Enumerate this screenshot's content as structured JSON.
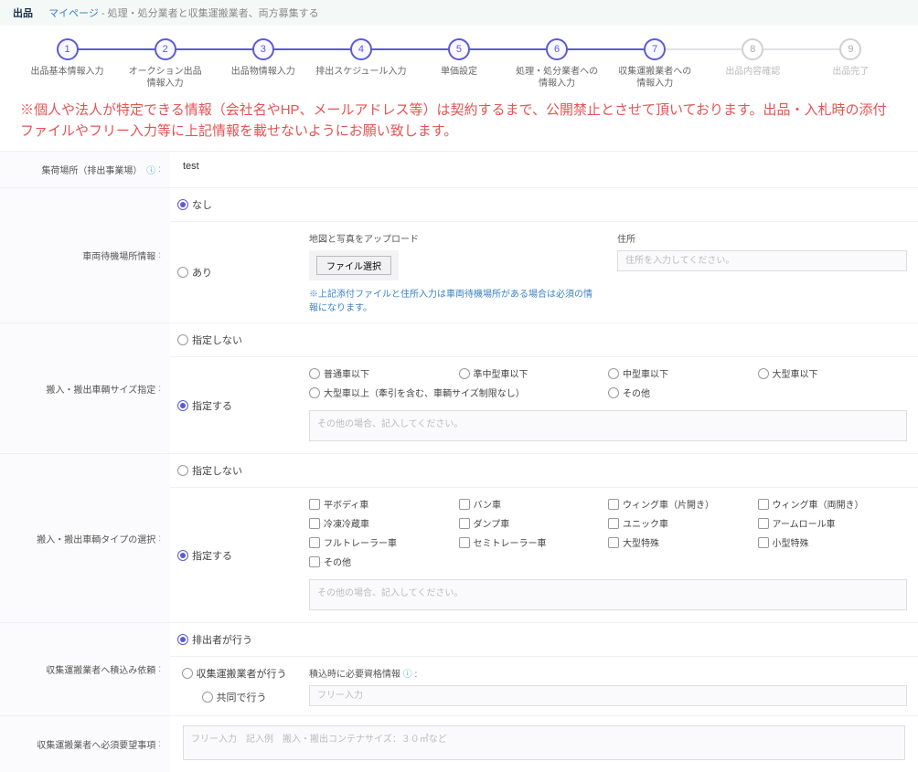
{
  "crumb": {
    "brand": "出品",
    "mypage": "マイページ",
    "text": "- 処理・処分業者と収集運搬業者、両方募集する"
  },
  "steps": [
    {
      "n": "1",
      "l": "出品基本情報入力",
      "state": "done"
    },
    {
      "n": "2",
      "l": "オークション出品\n情報入力",
      "state": "done"
    },
    {
      "n": "3",
      "l": "出品物情報入力",
      "state": "done"
    },
    {
      "n": "4",
      "l": "排出スケジュール入力",
      "state": "done"
    },
    {
      "n": "5",
      "l": "単価設定",
      "state": "done"
    },
    {
      "n": "6",
      "l": "処理・処分業者への\n情報入力",
      "state": "done"
    },
    {
      "n": "7",
      "l": "収集運搬業者への\n情報入力",
      "state": "done prefuture"
    },
    {
      "n": "8",
      "l": "出品内容確認",
      "state": "future"
    },
    {
      "n": "9",
      "l": "出品完了",
      "state": "future"
    }
  ],
  "warn": "※個人や法人が特定できる情報（会社名やHP、メールアドレス等）は契約するまで、公開禁止とさせて頂いております。出品・入札時の添付ファイルやフリー入力等に上記情報を載せないようにお願い致します。",
  "labels": {
    "pickup": "集荷場所（排出事業場）",
    "parking": "車両待機場所情報",
    "size": "搬入・搬出車輌サイズ指定",
    "type": "搬入・搬出車輌タイプの選択",
    "loadreq": "収集運搬業者へ積込み依頼",
    "must": "収集運搬業者へ必須要望事項"
  },
  "pickup_value": "test",
  "radio": {
    "none": "なし",
    "yes": "あり",
    "nospec": "指定しない",
    "spec": "指定する",
    "emitter": "排出者が行う",
    "collector": "収集運搬業者が行う",
    "together": "共同で行う"
  },
  "parking": {
    "upload_title": "地図と写真をアップロード",
    "file_btn": "ファイル選択",
    "addr_title": "住所",
    "addr_ph": "住所を入力してください。",
    "note": "※上記添付ファイルと住所入力は車両待機場所がある場合は必須の情報になります。"
  },
  "size": {
    "opts": [
      "普通車以下",
      "準中型車以下",
      "中型車以下",
      "大型車以下",
      "大型車以上（牽引を含む、車輌サイズ制限なし）",
      "",
      "その他",
      ""
    ],
    "other_ph": "その他の場合、記入してください。"
  },
  "type": {
    "opts": [
      "平ボディ車",
      "バン車",
      "ウィング車（片開き）",
      "ウィング車（両開き）",
      "冷凍冷蔵車",
      "ダンプ車",
      "ユニック車",
      "アームロール車",
      "フルトレーラー車",
      "セミトレーラー車",
      "大型特殊",
      "小型特殊",
      "その他"
    ],
    "other_ph": "その他の場合、記入してください。"
  },
  "loadreq": {
    "info_label": "積込時に必要資格情報",
    "free_ph": "フリー入力"
  },
  "must_ph": "フリー入力　記入例　搬入・搬出コンテナサイズ：３０㎡など"
}
